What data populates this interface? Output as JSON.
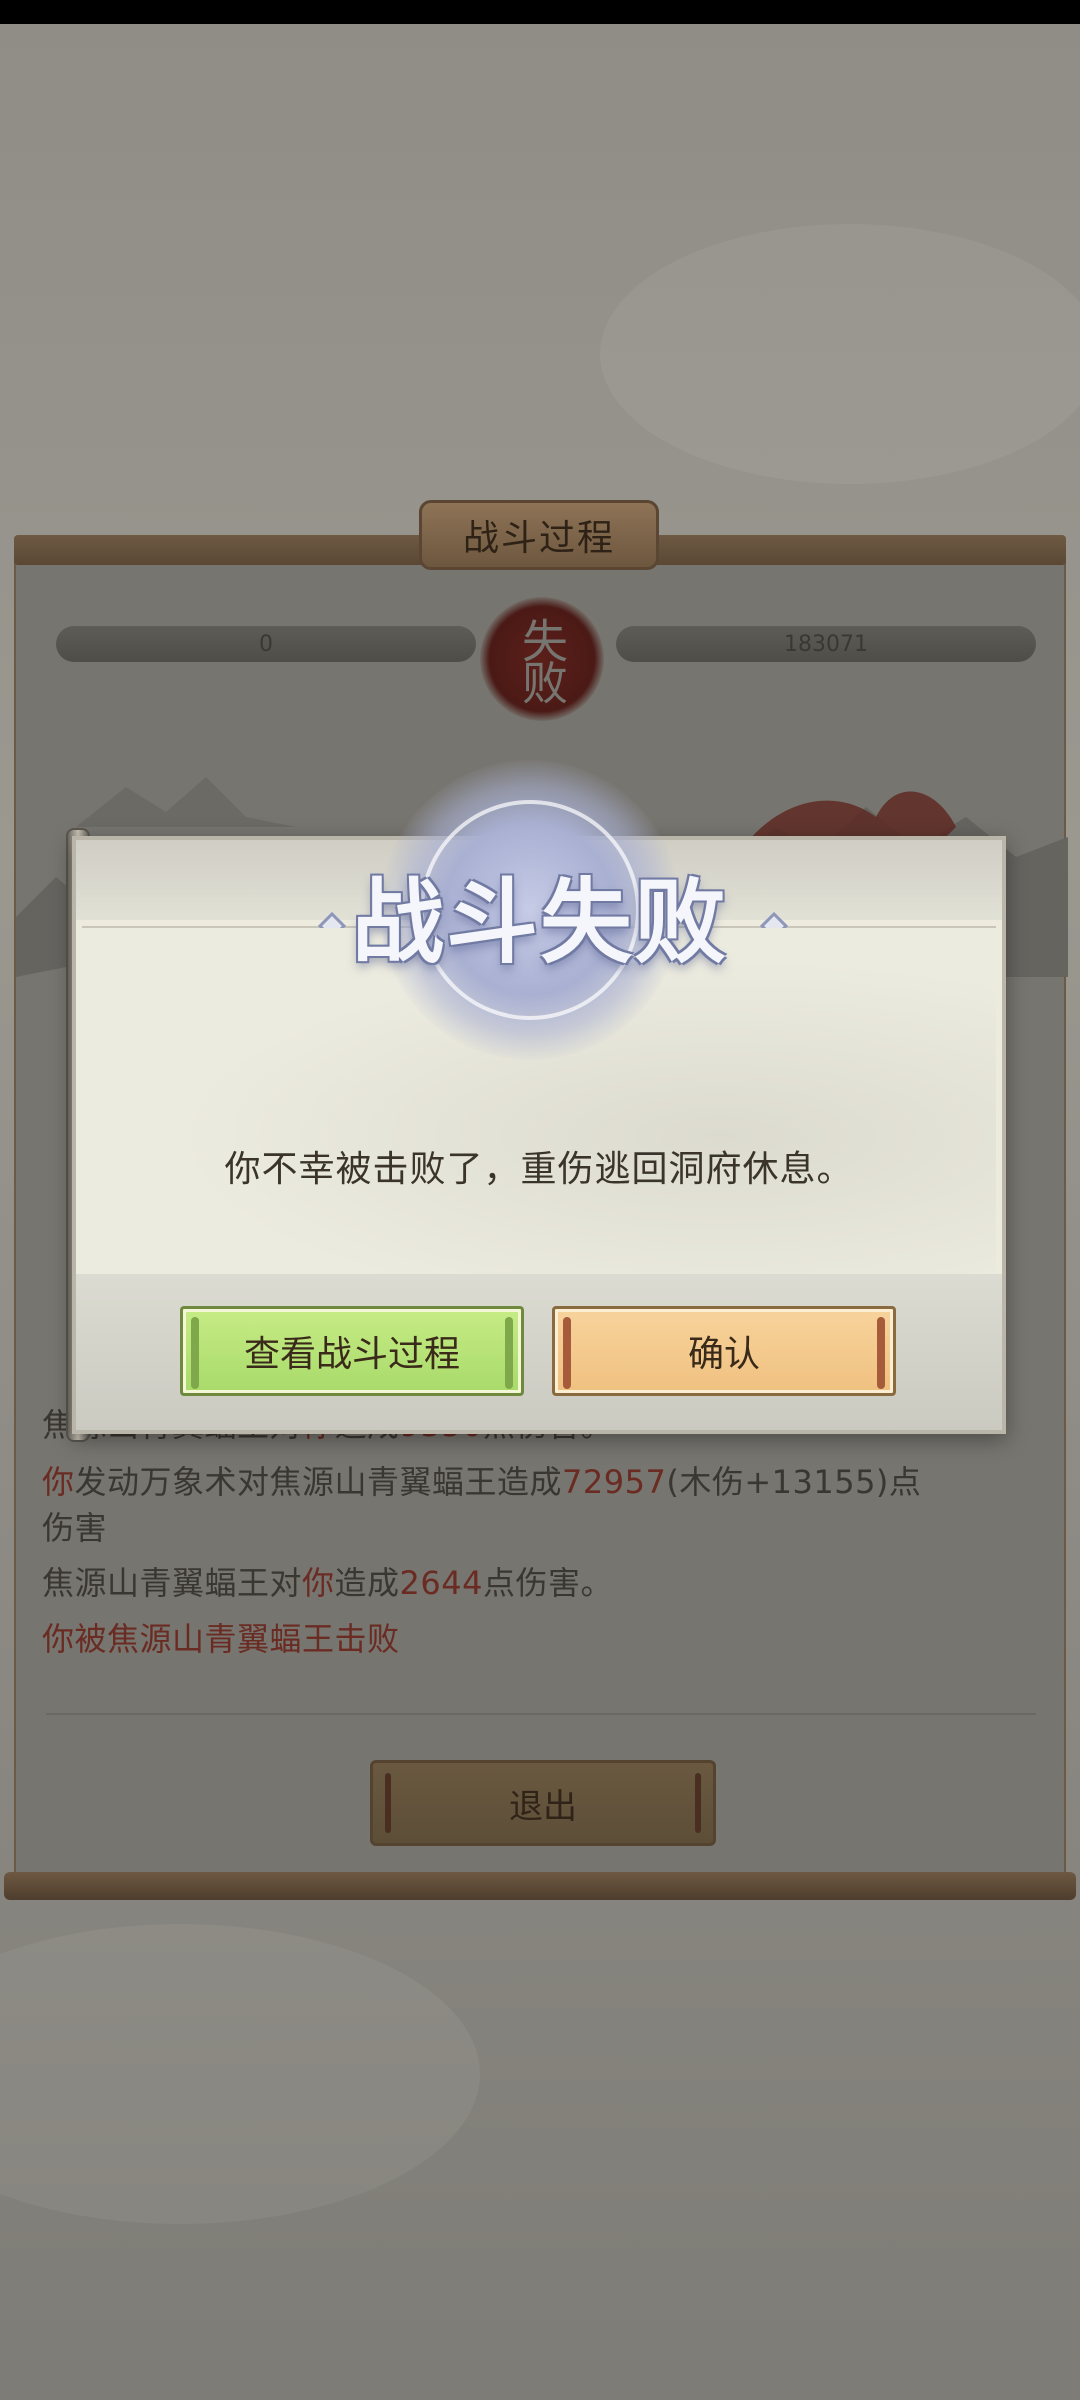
{
  "battle_panel": {
    "title": "战斗过程",
    "player_hp": "0",
    "enemy_hp": "183071",
    "result_seal": "失败"
  },
  "battle_log": {
    "lines": [
      [
        {
          "t": "焦源山青翼蝠王对"
        },
        {
          "t": "你",
          "hl": true
        },
        {
          "t": "造成"
        },
        {
          "t": "9350",
          "hl": true
        },
        {
          "t": "点伤害。"
        }
      ],
      [
        {
          "t": "你",
          "hl": true
        },
        {
          "t": "发动万象术对焦源山青翼蝠王造成"
        },
        {
          "t": "72957",
          "hl": true
        },
        {
          "t": "(木伤+13155)点"
        }
      ],
      [
        {
          "t": "伤害"
        }
      ],
      [
        {
          "t": "焦源山青翼蝠王对"
        },
        {
          "t": "你",
          "hl": true
        },
        {
          "t": "造成"
        },
        {
          "t": "2644",
          "hl": true
        },
        {
          "t": "点伤害。"
        }
      ],
      [
        {
          "t": "你被焦源山青翼蝠王击败",
          "hl": true
        }
      ]
    ]
  },
  "exit_button": "退出",
  "dialog": {
    "title": "战斗失败",
    "message": "你不幸被击败了，重伤逃回洞府休息。",
    "view_battle_button": "查看战斗过程",
    "confirm_button": "确认"
  },
  "colors": {
    "overlay_text": "#3a3631",
    "highlight": "#6a2b23",
    "view_button_green": "#b8e477",
    "confirm_button_orange": "#f3c88a"
  }
}
